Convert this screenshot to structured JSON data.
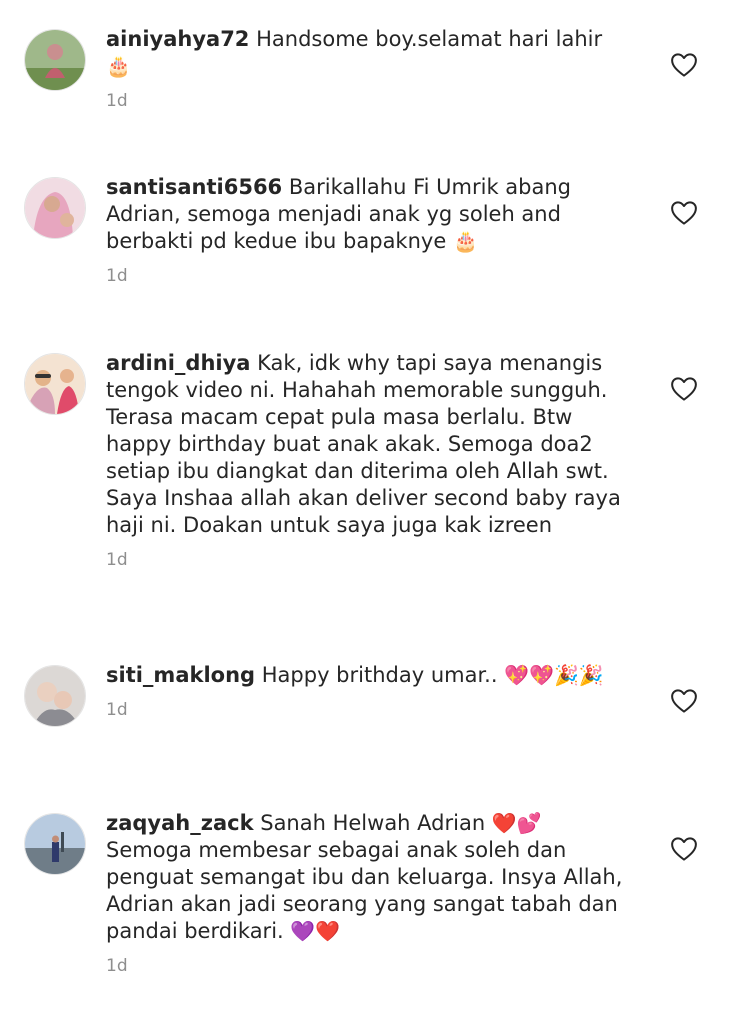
{
  "comments": [
    {
      "username": "ainiyahya72",
      "text": "Handsome boy.selamat hari lahir",
      "emoji": "🎂",
      "time": "1d",
      "avatar_color": "#7a9b6d"
    },
    {
      "username": "santisanti6566",
      "text": "Barikallahu Fi Umrik abang Adrian, semoga menjadi anak yg soleh and berbakti pd kedue ibu bapaknye",
      "emoji": "🎂",
      "time": "1d",
      "avatar_color": "#e8b4c8"
    },
    {
      "username": "ardini_dhiya",
      "text": "Kak, idk why tapi saya menangis tengok video ni. Hahahah memorable sungguh. Terasa macam cepat pula masa berlalu. Btw happy birthday buat anak akak. Semoga doa2 setiap ibu diangkat dan diterima oleh Allah swt. Saya Inshaa allah akan deliver second baby raya haji ni. Doakan untuk saya juga kak izreen",
      "emoji": "",
      "time": "1d",
      "avatar_color": "#d98aa0"
    },
    {
      "username": "siti_maklong",
      "text": "Happy brithday umar..",
      "emoji": "💖💖🎉🎉",
      "time": "1d",
      "avatar_color": "#c9c2bd"
    },
    {
      "username": "zaqyah_zack",
      "text": "Sanah Helwah Adrian",
      "emoji_inline": "❤️💕",
      "text2": "Semoga membesar sebagai anak soleh dan penguat semangat ibu dan keluarga. Insya Allah, Adrian akan jadi seorang yang sangat tabah dan pandai berdikari.",
      "emoji": "💜❤️",
      "time": "1d",
      "avatar_color": "#8aa7c7"
    }
  ],
  "icons": {
    "like": "heart-outline-icon"
  },
  "colors": {
    "username": "#262626",
    "text": "#262626",
    "timestamp": "#8e8e8e",
    "heart_stroke": "#262626"
  }
}
